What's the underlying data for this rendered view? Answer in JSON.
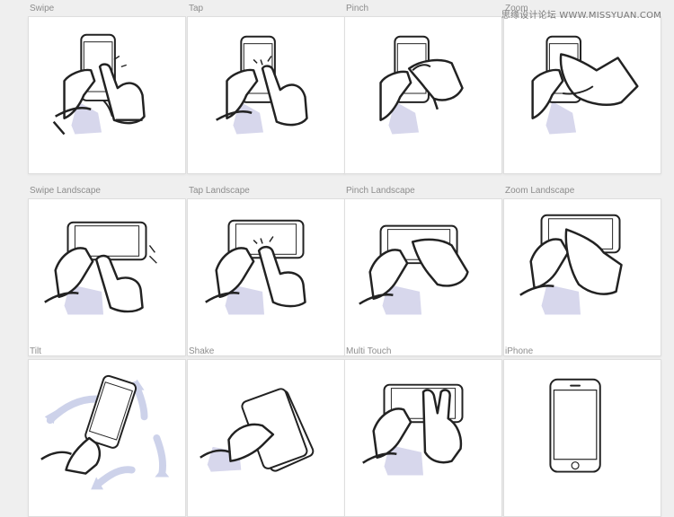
{
  "watermark": "思缘设计论坛 WWW.MISSYUAN.COM",
  "tiles": [
    {
      "label": "Swipe"
    },
    {
      "label": "Tap"
    },
    {
      "label": "Pinch"
    },
    {
      "label": "Zoom"
    },
    {
      "label": "Swipe Landscape"
    },
    {
      "label": "Tap Landscape"
    },
    {
      "label": "Pinch Landscape"
    },
    {
      "label": "Zoom Landscape"
    },
    {
      "label": "Tilt"
    },
    {
      "label": "Shake"
    },
    {
      "label": "Multi Touch"
    },
    {
      "label": "iPhone"
    }
  ],
  "colors": {
    "background": "#efefef",
    "card": "#ffffff",
    "stroke": "#222222",
    "shadow": "#d7d7ec",
    "arrow": "#cdd2ea",
    "label": "#8d8d8d"
  }
}
